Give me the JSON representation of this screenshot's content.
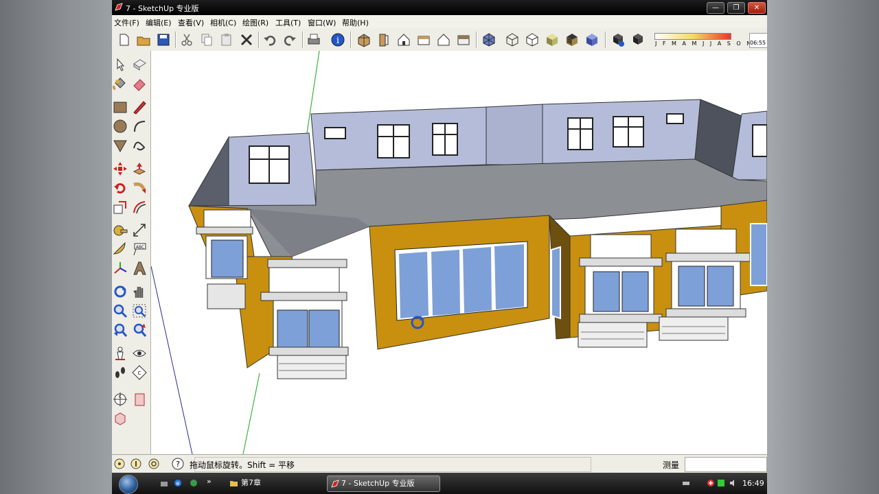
{
  "window": {
    "title": "7 - SketchUp 专业版",
    "buttons": {
      "minimize": "—",
      "restore": "❐",
      "close": "✕"
    }
  },
  "menu": [
    {
      "label": "文件(F)"
    },
    {
      "label": "编辑(E)"
    },
    {
      "label": "查看(V)"
    },
    {
      "label": "相机(C)"
    },
    {
      "label": "绘图(R)"
    },
    {
      "label": "工具(T)"
    },
    {
      "label": "窗口(W)"
    },
    {
      "label": "帮助(H)"
    }
  ],
  "shadow_settings": {
    "months": "J F M A M J J A S O N D",
    "time": "06:55"
  },
  "statusbar": {
    "hint": "拖动鼠标旋转。Shift = 平移",
    "measure_label": "测量",
    "measure_value": ""
  },
  "taskbar": {
    "chevron": "»",
    "items": [
      {
        "label": "第7章"
      },
      {
        "label": "7 - SketchUp 专业版"
      }
    ],
    "clock": "16:49"
  },
  "colors": {
    "wall_ochre": "#c8900e",
    "wall_blue": "#b4bcd9",
    "roof": "#8c8f94",
    "glass": "#7ea0d8",
    "titlebar": "#000000"
  }
}
